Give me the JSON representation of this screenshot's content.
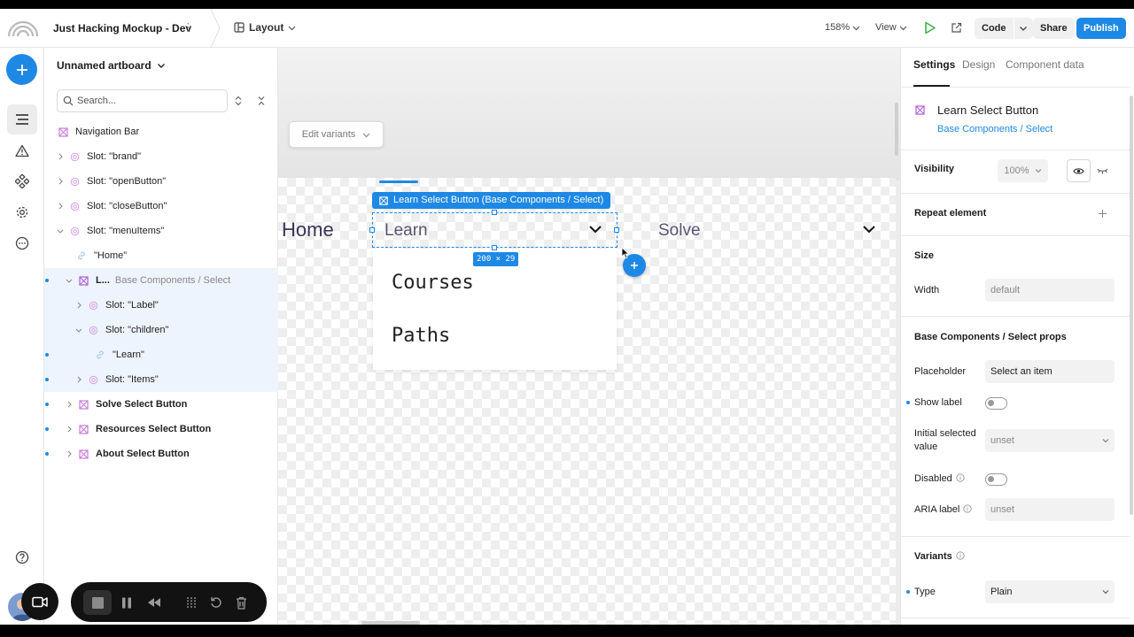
{
  "topbar": {
    "project_name": "Just Hacking Mockup - Dev",
    "layout_label": "Layout",
    "zoom_label": "158%",
    "view_label": "View",
    "code_label": "Code",
    "share_label": "Share",
    "publish_label": "Publish"
  },
  "layers": {
    "artboard_title": "Unnamed artboard",
    "search_placeholder": "Search...",
    "rows": [
      {
        "label": "Navigation Bar",
        "muted": ""
      },
      {
        "label": "Slot: \"brand\"",
        "muted": ""
      },
      {
        "label": "Slot: \"openButton\"",
        "muted": ""
      },
      {
        "label": "Slot: \"closeButton\"",
        "muted": ""
      },
      {
        "label": "Slot: \"menuItems\"",
        "muted": ""
      },
      {
        "label": "\"Home\"",
        "muted": ""
      },
      {
        "label": "L...",
        "muted": "Base Components / Select"
      },
      {
        "label": "Slot: \"Label\"",
        "muted": ""
      },
      {
        "label": "Slot: \"children\"",
        "muted": ""
      },
      {
        "label": "\"Learn\"",
        "muted": ""
      },
      {
        "label": "Slot: \"Items\"",
        "muted": ""
      },
      {
        "label": "Solve Select Button",
        "muted": ""
      },
      {
        "label": "Resources Select Button",
        "muted": ""
      },
      {
        "label": "About Select Button",
        "muted": ""
      }
    ]
  },
  "canvas": {
    "edit_variants_label": "Edit variants",
    "selection_label": "Learn Select Button (Base Components / Select)",
    "dimensions_label": "200 × 29",
    "nav_home": "Home",
    "nav_learn": "Learn",
    "nav_solve": "Solve",
    "dropdown_items": [
      "Courses",
      "Paths"
    ]
  },
  "right_panel": {
    "tabs": [
      "Settings",
      "Design",
      "Component data"
    ],
    "component_title": "Learn Select Button",
    "component_path": "Base Components / Select",
    "visibility_label": "Visibility",
    "visibility_value": "100%",
    "repeat_label": "Repeat element",
    "size_label": "Size",
    "width_label": "Width",
    "width_value": "default",
    "props_title": "Base Components / Select props",
    "placeholder_label": "Placeholder",
    "placeholder_value": "Select an item",
    "show_label_label": "Show label",
    "initial_selected_label": "Initial selected value",
    "initial_selected_value": "unset",
    "disabled_label": "Disabled",
    "aria_label_label": "ARIA label",
    "aria_label_value": "unset",
    "variants_label": "Variants",
    "type_label": "Type",
    "type_value": "Plain"
  },
  "colors": {
    "accent": "#1e88e5",
    "component_purple": "#b05bd6",
    "slot_icon": "#c77ad9",
    "nav_text": "#3a3358"
  },
  "icons": {
    "play": "play-icon",
    "open_external": "external-link-icon",
    "add": "plus-icon",
    "layers": "layers-list-icon",
    "warning": "warning-icon",
    "components": "components-icon",
    "settings": "gear-icon",
    "more": "more-icon",
    "help": "help-icon",
    "recording": [
      "camera-icon",
      "stop-icon",
      "pause-icon",
      "rewind-icon",
      "grid-icon",
      "restart-icon",
      "trash-icon"
    ]
  }
}
